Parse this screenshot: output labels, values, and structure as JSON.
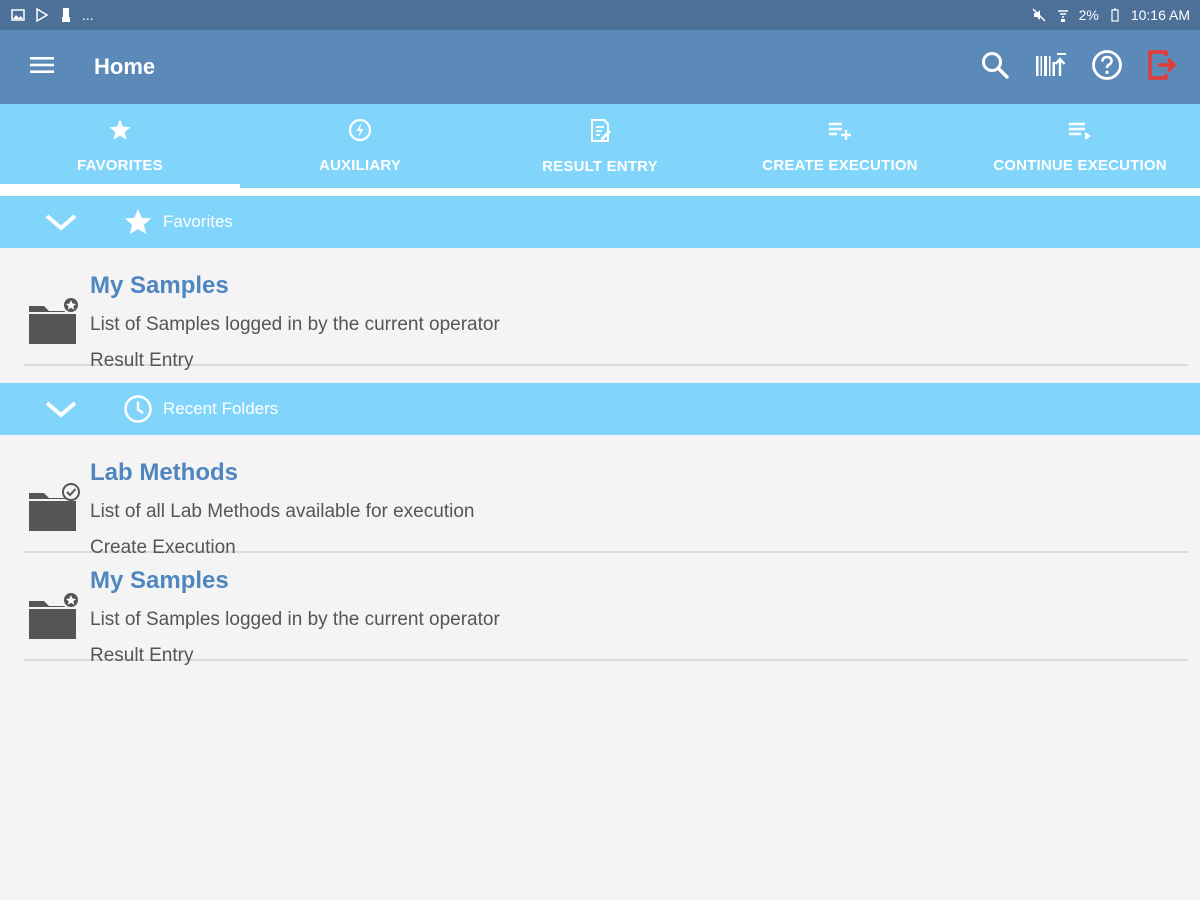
{
  "status_bar": {
    "left_text": "...",
    "battery": "2%",
    "time": "10:16 AM"
  },
  "app_bar": {
    "title": "Home",
    "exit_color": "#e53935"
  },
  "tabs": [
    {
      "label": "FAVORITES",
      "icon": "star-icon",
      "active": true
    },
    {
      "label": "AUXILIARY",
      "icon": "lightning-circle-icon",
      "active": false
    },
    {
      "label": "RESULT ENTRY",
      "icon": "clipboard-edit-icon",
      "active": false
    },
    {
      "label": "CREATE EXECUTION",
      "icon": "playlist-add-icon",
      "active": false
    },
    {
      "label": "CONTINUE EXECUTION",
      "icon": "playlist-play-icon",
      "active": false
    }
  ],
  "sections": [
    {
      "label": "Favorites",
      "icon": "star-icon",
      "items": [
        {
          "title": "My Samples",
          "description": "List of Samples logged in by the current operator",
          "type": "Result Entry",
          "icon": "folder-star-icon"
        }
      ]
    },
    {
      "label": "Recent Folders",
      "icon": "clock-icon",
      "items": [
        {
          "title": "Lab Methods",
          "description": "List of all Lab Methods available for execution",
          "type": "Create Execution",
          "icon": "folder-check-icon"
        },
        {
          "title": "My Samples",
          "description": "List of Samples logged in by the current operator",
          "type": "Result Entry",
          "icon": "folder-star-icon"
        }
      ]
    }
  ],
  "colors": {
    "status_bar": "#4d7099",
    "app_bar": "#5b8ab8",
    "tab_bar": "#81d4fa",
    "item_title": "#4f86c0"
  }
}
